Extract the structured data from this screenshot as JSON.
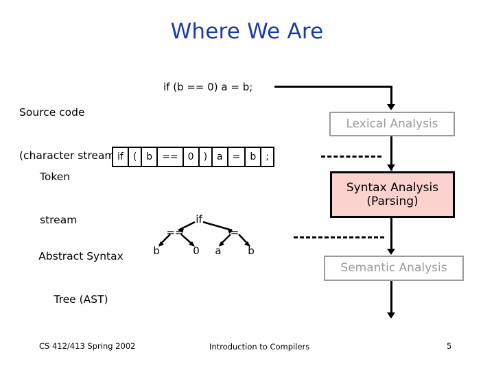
{
  "slide": {
    "title": "Where We Are",
    "title_color": "#1b3aa8",
    "background": "#ffffff"
  },
  "stages": {
    "source": {
      "label_line1": "Source code",
      "label_line2": "(character stream)",
      "code": "if (b == 0) a = b;"
    },
    "token": {
      "label_line1": "Token",
      "label_line2": "stream",
      "tokens": [
        "if",
        "(",
        "b",
        "==",
        "0",
        ")",
        "a",
        "=",
        "b",
        ";"
      ]
    },
    "ast": {
      "label_line1": "Abstract Syntax",
      "label_line2": "Tree (AST)",
      "nodes": {
        "root": "if",
        "left_op": "==",
        "right_op": "=",
        "leaf1": "b",
        "leaf2": "0",
        "leaf3": "a",
        "leaf4": "b"
      }
    }
  },
  "phases": [
    {
      "name": "lexical",
      "label": "Lexical Analysis",
      "text_color": "#9a9a9a",
      "border_color": "#9a9a9a",
      "fill_color": "#ffffff",
      "highlighted": false
    },
    {
      "name": "syntax",
      "label": "Syntax Analysis\n(Parsing)",
      "text_color": "#000000",
      "border_color": "#000000",
      "fill_color": "#fbd2cd",
      "highlighted": true
    },
    {
      "name": "semantic",
      "label": "Semantic Analysis",
      "text_color": "#9a9a9a",
      "border_color": "#9a9a9a",
      "fill_color": "#ffffff",
      "highlighted": false
    }
  ],
  "footer": {
    "course": "CS 412/413   Spring 2002",
    "center": "Introduction to Compilers",
    "page": "5"
  }
}
